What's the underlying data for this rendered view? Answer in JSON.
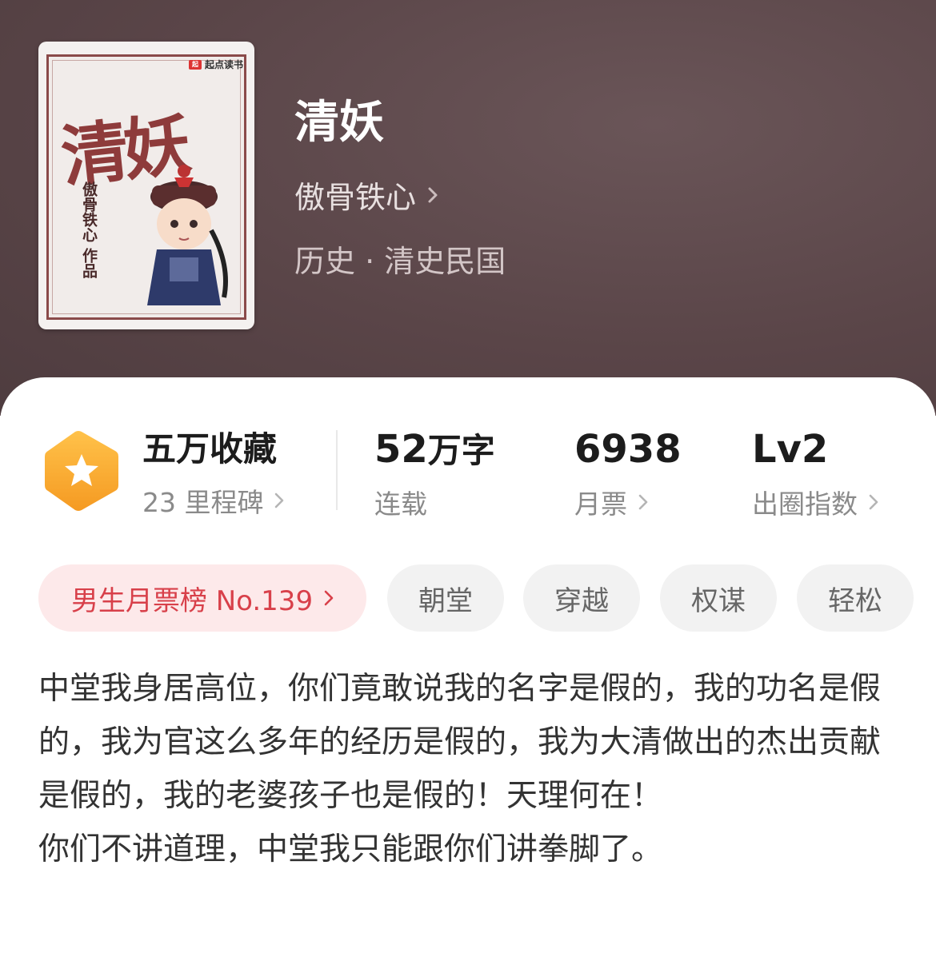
{
  "cover": {
    "publisher_logo": "起点读书",
    "title_art": "清妖",
    "author_art": "傲骨铁心 作品"
  },
  "book": {
    "title": "清妖",
    "author": "傲骨铁心",
    "genre": "历史 · 清史民国"
  },
  "stats": {
    "favorites": {
      "value": "五万收藏",
      "sub": "23 里程碑",
      "icon": "star-badge-icon",
      "color": "#f5a623"
    },
    "words": {
      "number": "52",
      "unit": "万字",
      "sub": "连载"
    },
    "tickets": {
      "value": "6938",
      "sub": "月票"
    },
    "index": {
      "value": "Lv2",
      "sub": "出圈指数"
    }
  },
  "tags": {
    "rank": "男生月票榜 No.139",
    "items": [
      "朝堂",
      "穿越",
      "权谋",
      "轻松"
    ]
  },
  "synopsis": {
    "lines": [
      "中堂我身居高位，你们竟敢说我的名字是假的，我的功名是假的，我为官这么多年的经历是假的，我为大清做出的杰出贡献是假的，我的老婆孩子也是假的！天理何在！",
      "你们不讲道理，中堂我只能跟你们讲拳脚了。"
    ]
  },
  "colors": {
    "header_bg": "#5a4548",
    "accent_rank": "#d8404a",
    "rank_bg": "#fde9ea",
    "tag_bg": "#f2f2f2"
  }
}
